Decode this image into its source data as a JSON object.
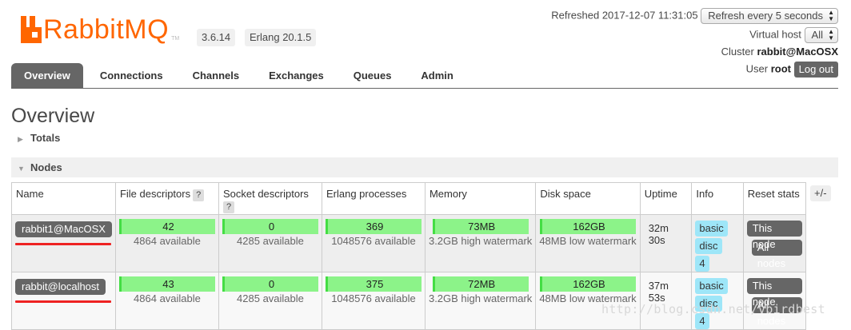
{
  "header": {
    "logo_text": "RabbitMQ",
    "logo_tm": "TM",
    "version": "3.6.14",
    "erlang": "Erlang 20.1.5",
    "refreshed_label": "Refreshed 2017-12-07 11:31:05",
    "refresh_select": "Refresh every 5 seconds",
    "vhost_label": "Virtual host",
    "vhost_select": "All",
    "cluster_label": "Cluster",
    "cluster_name": "rabbit@MacOSX",
    "user_label": "User",
    "user_name": "root",
    "logout_label": "Log out"
  },
  "tabs": [
    {
      "label": "Overview",
      "active": true
    },
    {
      "label": "Connections"
    },
    {
      "label": "Channels"
    },
    {
      "label": "Exchanges"
    },
    {
      "label": "Queues"
    },
    {
      "label": "Admin"
    }
  ],
  "page_title": "Overview",
  "sections": {
    "totals": "Totals",
    "nodes": "Nodes"
  },
  "table": {
    "headers": {
      "name": "Name",
      "file_descriptors": "File descriptors",
      "socket_descriptors": "Socket descriptors",
      "erlang_processes": "Erlang processes",
      "memory": "Memory",
      "disk_space": "Disk space",
      "uptime": "Uptime",
      "info": "Info",
      "reset_stats": "Reset stats"
    },
    "help_mark": "?",
    "plus_minus": "+/-",
    "rows": [
      {
        "name": "rabbit1@MacOSX",
        "fd": "42",
        "fd_avail": "4864 available",
        "sd": "0",
        "sd_avail": "4285 available",
        "ep": "369",
        "ep_avail": "1048576 available",
        "mem": "73MB",
        "mem_sub": "3.2GB high watermark",
        "disk": "162GB",
        "disk_sub": "48MB low watermark",
        "uptime_1": "32m",
        "uptime_2": "30s",
        "info_basic": "basic",
        "info_disc": "disc",
        "info_num": "4",
        "this_node": "This node",
        "all_nodes": "All nodes"
      },
      {
        "name": "rabbit@localhost",
        "fd": "43",
        "fd_avail": "4864 available",
        "sd": "0",
        "sd_avail": "4285 available",
        "ep": "375",
        "ep_avail": "1048576 available",
        "mem": "72MB",
        "mem_sub": "3.2GB high watermark",
        "disk": "162GB",
        "disk_sub": "48MB low watermark",
        "uptime_1": "37m",
        "uptime_2": "53s",
        "info_basic": "basic",
        "info_disc": "disc",
        "info_num": "4",
        "this_node": "This node",
        "all_nodes": "All nodes"
      }
    ]
  },
  "watermark": "http://blog.csdn.net/vbirdbest",
  "colors": {
    "brand": "#ff6600",
    "bar_green": "#8cf389",
    "info_badge": "#9ee6f8",
    "annotation_red": "#ee2222"
  }
}
